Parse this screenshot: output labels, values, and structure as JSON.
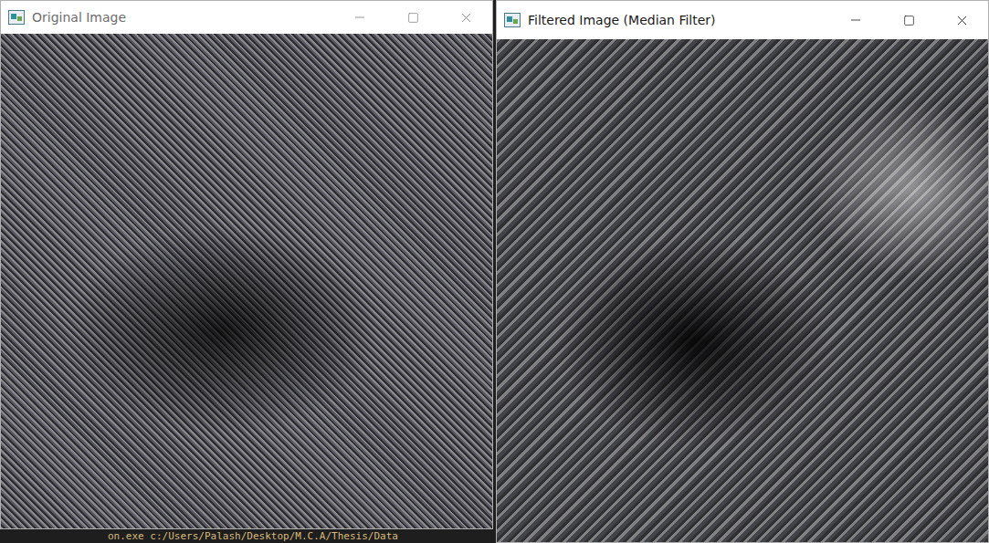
{
  "windows": [
    {
      "title": "Original Image",
      "active": false,
      "kind": "original"
    },
    {
      "title": "Filtered Image (Median Filter)",
      "active": true,
      "kind": "filtered"
    }
  ],
  "terminal": {
    "text": "on.exe c:/Users/Palash/Desktop/M.C.A/Thesis/Data"
  }
}
